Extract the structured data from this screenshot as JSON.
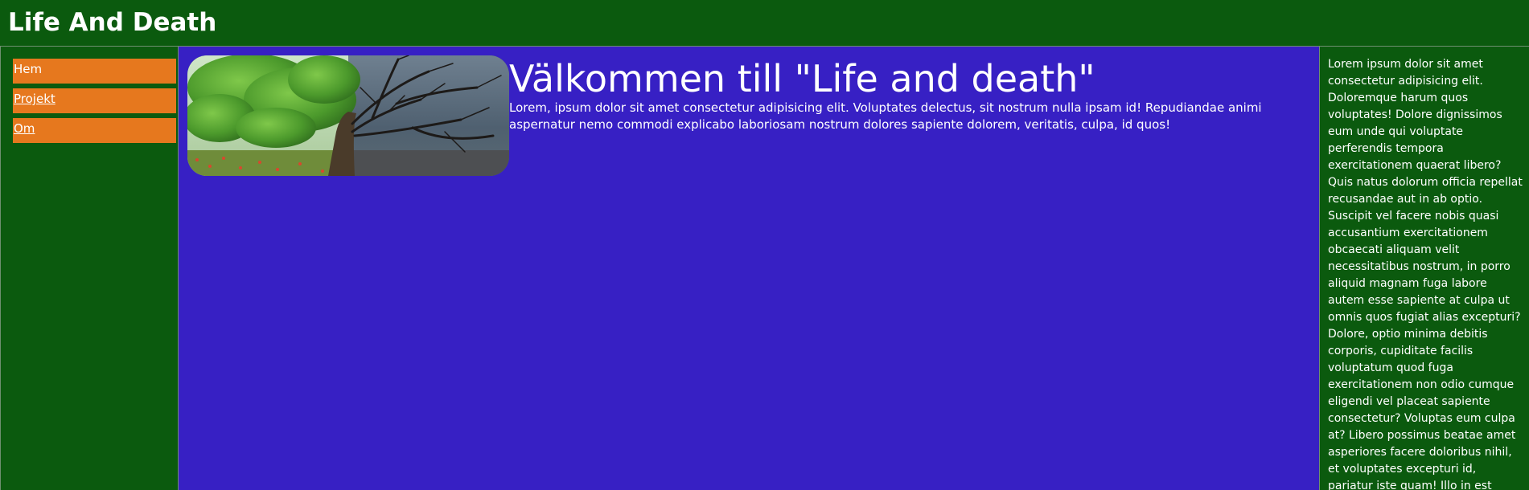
{
  "header": {
    "title": "Life And Death"
  },
  "nav": {
    "items": [
      {
        "label": "Hem"
      },
      {
        "label": "Projekt"
      },
      {
        "label": "Om"
      }
    ]
  },
  "main": {
    "hero_image": "tree-life-death-image",
    "heading": "Välkommen till \"Life and death\"",
    "intro": "Lorem, ipsum dolor sit amet consectetur adipisicing elit. Voluptates delectus, sit nostrum nulla ipsam id! Repudiandae animi aspernatur nemo commodi explicabo laboriosam nostrum dolores sapiente dolorem, veritatis, culpa, id quos!"
  },
  "aside": {
    "text": "Lorem ipsum dolor sit amet consectetur adipisicing elit. Doloremque harum quos voluptates! Dolore dignissimos eum unde qui voluptate perferendis tempora exercitationem quaerat libero? Quis natus dolorum officia repellat recusandae aut in ab optio. Suscipit vel facere nobis quasi accusantium exercitationem obcaecati aliquam velit necessitatibus nostrum, in porro aliquid magnam fuga labore autem esse sapiente at culpa ut omnis quos fugiat alias excepturi? Dolore, optio minima debitis corporis, cupiditate facilis voluptatum quod fuga exercitationem non odio cumque eligendi vel placeat sapiente consectetur? Voluptas eum culpa at? Libero possimus beatae amet asperiores facere doloribus nihil, et voluptates excepturi id, pariatur iste quam! Illo in est"
  },
  "colors": {
    "header_bg": "#0b5a0e",
    "nav_item_bg": "#e6781e",
    "main_bg": "#3720c4",
    "text": "#ffffff"
  }
}
